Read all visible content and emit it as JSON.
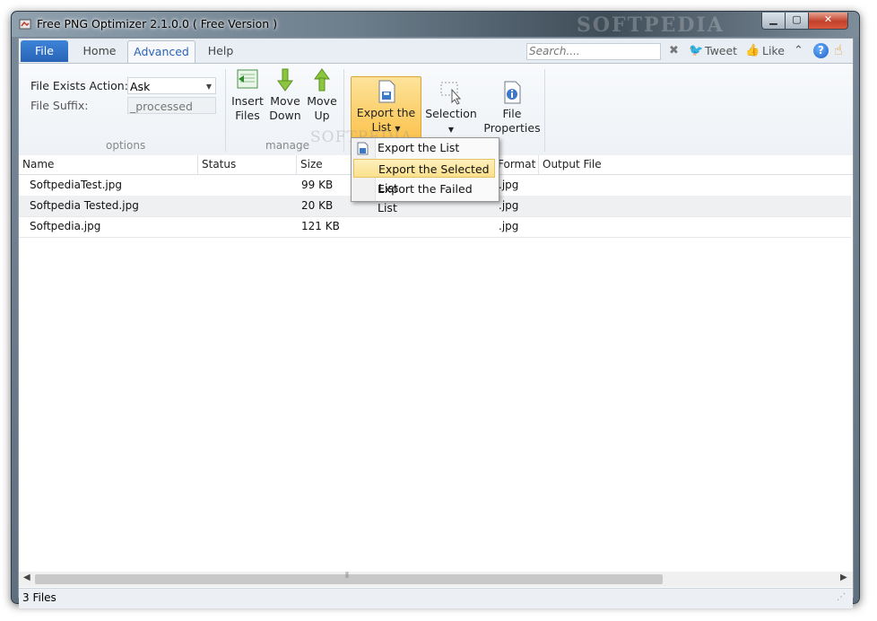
{
  "window": {
    "title": "Free PNG Optimizer 2.1.0.0 ( Free Version )",
    "watermark": "SOFTPEDIA"
  },
  "tabs": {
    "file": "File",
    "home": "Home",
    "advanced": "Advanced",
    "help": "Help"
  },
  "search": {
    "placeholder": "Search...."
  },
  "social": {
    "tweet": "Tweet",
    "like": "Like",
    "help_glyph": "?"
  },
  "options": {
    "file_exists_label": "File Exists Action:",
    "file_exists_value": "Ask",
    "file_suffix_label": "File Suffix:",
    "file_suffix_value": "_processed",
    "group_label": "options"
  },
  "manage": {
    "insert_files": [
      "Insert",
      "Files"
    ],
    "move_down": [
      "Move",
      "Down"
    ],
    "move_up": [
      "Move",
      "Up"
    ],
    "group_label": "manage"
  },
  "export": {
    "export_list": [
      "Export the",
      "List"
    ],
    "selection": "Selection",
    "file_properties": [
      "File",
      "Properties"
    ]
  },
  "menu": {
    "items": [
      "Export the List",
      "Export the Selected List",
      "Export the Failed List"
    ],
    "highlighted_index": 1
  },
  "columns": [
    "Name",
    "Status",
    "Size",
    "Format",
    "Output File"
  ],
  "rows": [
    {
      "name": "SoftpediaTest.jpg",
      "status": "",
      "size": "99 KB",
      "format": ".jpg",
      "output": ""
    },
    {
      "name": "Softpedia Tested.jpg",
      "status": "",
      "size": "20 KB",
      "format": ".jpg",
      "output": ""
    },
    {
      "name": "Softpedia.jpg",
      "status": "",
      "size": "121 KB",
      "format": ".jpg",
      "output": ""
    }
  ],
  "status": {
    "text": "3 Files"
  },
  "colors": {
    "file_tab": "#2a6bc6",
    "accent_tab_text": "#2a63b4",
    "export_highlight": "#fbc24b"
  }
}
